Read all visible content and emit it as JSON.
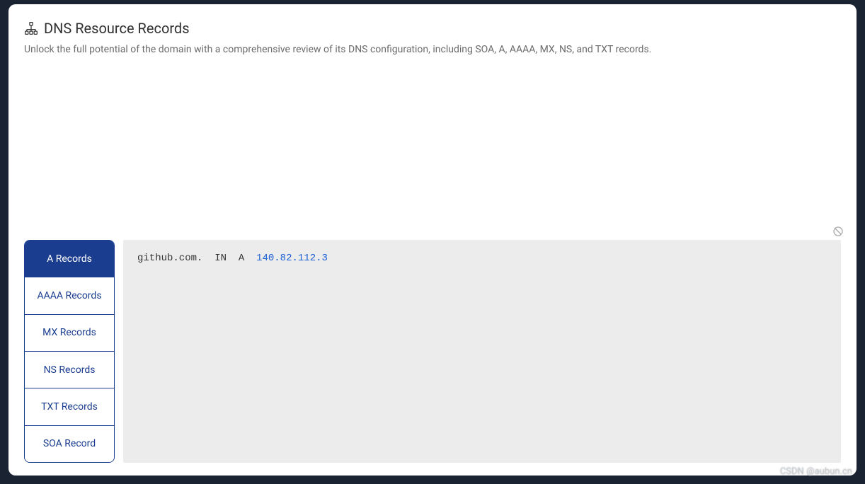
{
  "header": {
    "title": "DNS Resource Records",
    "subtitle": "Unlock the full potential of the domain with a comprehensive review of its DNS configuration, including SOA, A, AAAA, MX, NS, and TXT records."
  },
  "tabs": [
    {
      "label": "A Records",
      "active": true
    },
    {
      "label": "AAAA Records",
      "active": false
    },
    {
      "label": "MX Records",
      "active": false
    },
    {
      "label": "NS Records",
      "active": false
    },
    {
      "label": "TXT Records",
      "active": false
    },
    {
      "label": "SOA Record",
      "active": false
    }
  ],
  "record": {
    "domain": "github.com.",
    "class": "IN",
    "type": "A",
    "value": "140.82.112.3"
  },
  "watermark": "CSDN @aubun.cn"
}
